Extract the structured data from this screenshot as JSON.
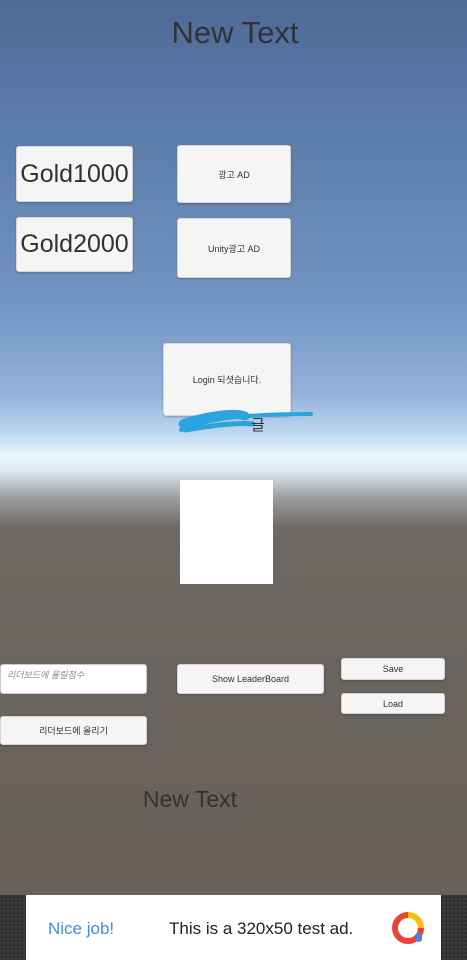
{
  "top_text": "New Text",
  "bottom_text": "New Text",
  "buttons": {
    "gold1000": "Gold1000",
    "gold2000": "Gold2000",
    "ad": "광고 AD",
    "unity_ad": "Unity광고 AD",
    "login": "Login 되셧습니다.",
    "show_leaderboard": "Show LeaderBoard",
    "save": "Save",
    "load": "Load",
    "post_leaderboard": "리더보드에 올리기"
  },
  "score_input": {
    "placeholder": "리더보드에 올릴점수"
  },
  "status_label": "글",
  "ad_banner": {
    "nice": "Nice job!",
    "desc": "This is a 320x50 test ad.",
    "logo_icon": "admob-logo-icon"
  }
}
